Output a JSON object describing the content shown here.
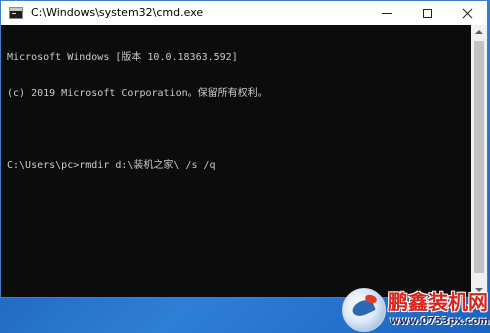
{
  "window": {
    "title": "C:\\Windows\\system32\\cmd.exe",
    "controls": {
      "minimize": "minimize",
      "maximize": "maximize",
      "close": "close"
    }
  },
  "console": {
    "lines": [
      "Microsoft Windows [版本 10.0.18363.592]",
      "(c) 2019 Microsoft Corporation。保留所有权利。",
      "",
      "C:\\Users\\pc>rmdir d:\\装机之家\\ /s /q"
    ]
  },
  "watermark": {
    "brand": "鹏鑫装机网",
    "url": "www.0753px.com"
  },
  "colors": {
    "console_bg": "#0c0c0c",
    "console_text": "#cccccc",
    "titlebar_bg": "#ffffff",
    "desktop": "#1c6ec8",
    "brand_red": "#d8261c"
  },
  "icons": {
    "app": "cmd-console-icon",
    "minimize": "minimize-icon",
    "maximize": "maximize-icon",
    "close": "close-icon",
    "scroll_up": "scroll-up-arrow-icon",
    "scroll_down": "scroll-down-arrow-icon",
    "logo": "brand-logo-icon"
  }
}
